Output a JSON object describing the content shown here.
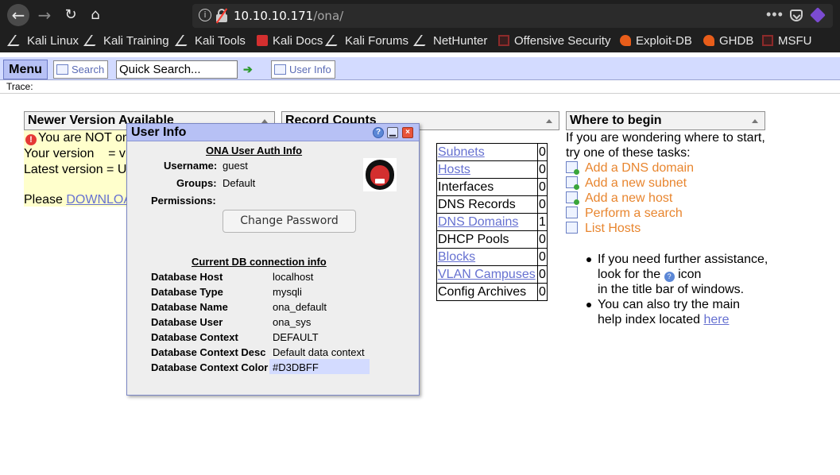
{
  "browser": {
    "url_host": "10.10.10.171",
    "url_path": "/ona/",
    "more_label": "•••",
    "bookmarks": [
      {
        "label": "Kali Linux",
        "icon": "kali-dragon-icon"
      },
      {
        "label": "Kali Training",
        "icon": "kali-dragon-icon"
      },
      {
        "label": "Kali Tools",
        "icon": "kali-dragon-icon"
      },
      {
        "label": "Kali Docs",
        "icon": "kali-docs-icon"
      },
      {
        "label": "Kali Forums",
        "icon": "kali-dragon-icon"
      },
      {
        "label": "NetHunter",
        "icon": "kali-dragon-icon"
      },
      {
        "label": "Offensive Security",
        "icon": "offsec-icon"
      },
      {
        "label": "Exploit-DB",
        "icon": "exploitdb-icon"
      },
      {
        "label": "GHDB",
        "icon": "exploitdb-icon"
      },
      {
        "label": "MSFU",
        "icon": "offsec-icon"
      }
    ]
  },
  "ona": {
    "menu_label": "Menu",
    "search_label": "Search",
    "quick_search_value": "Quick Search...",
    "user_info_label": "User Info",
    "trace_label": "Trace:",
    "accent_color": "#D3DBFF"
  },
  "newer_version": {
    "title": "Newer Version Available",
    "line1": "You are NOT on",
    "line2": "Your version    = v1",
    "line3": "Latest version = U",
    "line4_prefix": "Please ",
    "line4_link": "DOWNLOA"
  },
  "record_counts": {
    "title": "Record Counts",
    "rows": [
      {
        "name": "Subnets",
        "count": "0",
        "link": true
      },
      {
        "name": "Hosts",
        "count": "0",
        "link": true
      },
      {
        "name": "Interfaces",
        "count": "0",
        "link": false
      },
      {
        "name": "DNS Records",
        "count": "0",
        "link": false
      },
      {
        "name": "DNS Domains",
        "count": "1",
        "link": true
      },
      {
        "name": "DHCP Pools",
        "count": "0",
        "link": false
      },
      {
        "name": "Blocks",
        "count": "0",
        "link": true
      },
      {
        "name": "VLAN Campuses",
        "count": "0",
        "link": true
      },
      {
        "name": "Config Archives",
        "count": "0",
        "link": false
      }
    ]
  },
  "where_to_begin": {
    "title": "Where to begin",
    "intro1": "If you are wondering where to start,",
    "intro2": "try one of these tasks:",
    "tasks": [
      {
        "label": "Add a DNS domain",
        "icon": "add-dns-domain-icon"
      },
      {
        "label": "Add a new subnet",
        "icon": "add-subnet-icon"
      },
      {
        "label": "Add a new host",
        "icon": "add-host-icon"
      },
      {
        "label": "Perform a search",
        "icon": "search-icon"
      },
      {
        "label": "List Hosts",
        "icon": "list-icon"
      }
    ],
    "bullet1_a": "If you need further assistance,",
    "bullet1_b": "look for the",
    "bullet1_c": "icon",
    "bullet1_d": "in the title bar of windows.",
    "bullet2_a": "You can also try the main",
    "bullet2_b": "help index located ",
    "bullet2_link": "here"
  },
  "user_info_popup": {
    "title": "User Info",
    "auth_heading": "ONA User Auth Info",
    "username_label": "Username:",
    "username_value": "guest",
    "groups_label": "Groups:",
    "groups_value": "Default",
    "permissions_label": "Permissions:",
    "change_password_label": "Change Password",
    "db_heading": "Current DB connection info",
    "db_rows": [
      {
        "label": "Database Host",
        "value": "localhost"
      },
      {
        "label": "Database Type",
        "value": "mysqli"
      },
      {
        "label": "Database Name",
        "value": "ona_default"
      },
      {
        "label": "Database User",
        "value": "ona_sys"
      },
      {
        "label": "Database Context",
        "value": "DEFAULT"
      },
      {
        "label": "Database Context Desc",
        "value": "Default data context"
      },
      {
        "label": "Database Context Color",
        "value": "#D3DBFF"
      }
    ]
  }
}
